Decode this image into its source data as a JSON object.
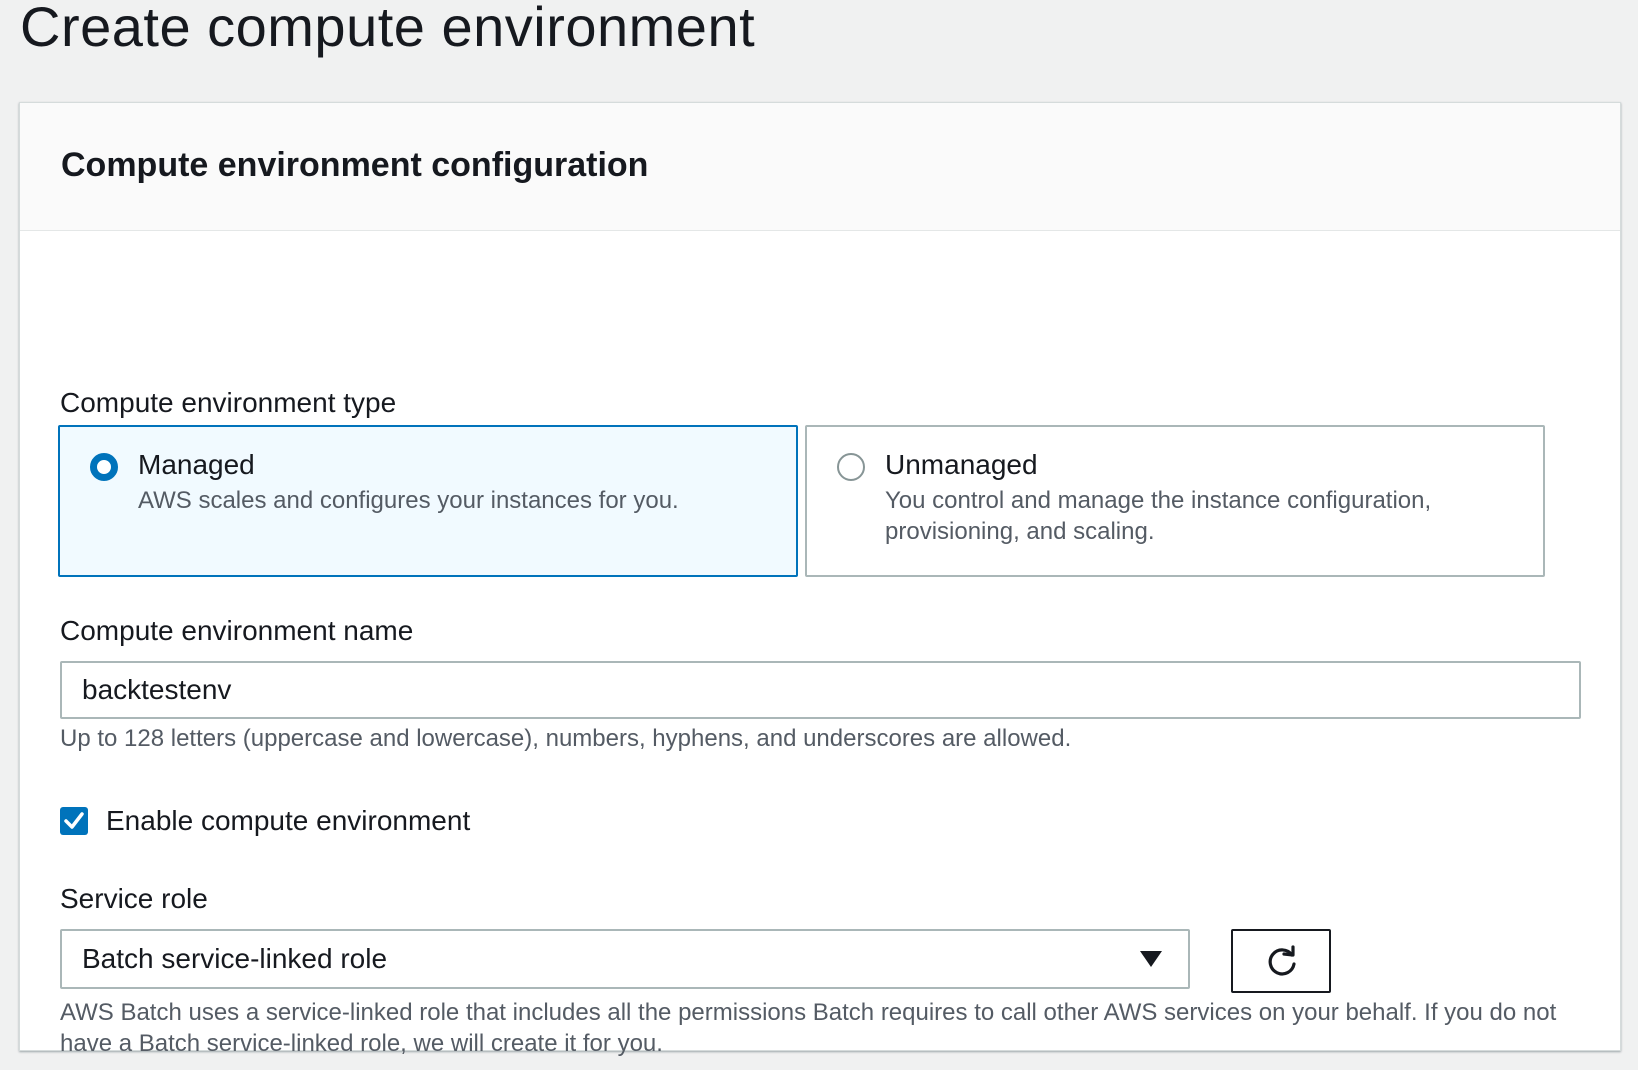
{
  "page": {
    "title": "Create compute environment"
  },
  "panel": {
    "heading": "Compute environment configuration"
  },
  "env_type": {
    "label": "Compute environment type",
    "options": [
      {
        "title": "Managed",
        "description": "AWS scales and configures your instances for you.",
        "selected": true
      },
      {
        "title": "Unmanaged",
        "description": "You control and manage the instance configuration, provisioning, and scaling.",
        "selected": false
      }
    ]
  },
  "env_name": {
    "label": "Compute environment name",
    "value": "backtestenv",
    "hint": "Up to 128 letters (uppercase and lowercase), numbers, hyphens, and underscores are allowed."
  },
  "enable": {
    "label": "Enable compute environment",
    "checked": true
  },
  "service_role": {
    "label": "Service role",
    "selected": "Batch service-linked role",
    "hint": "AWS Batch uses a service-linked role that includes all the permissions Batch requires to call other AWS services on your behalf. If you do not have a Batch service-linked role, we will create it for you."
  },
  "icons": {
    "radio_selected": "radio-selected-icon",
    "radio_unselected": "radio-unselected-icon",
    "checkbox_checked": "check-icon",
    "dropdown": "caret-down-icon",
    "refresh": "refresh-icon"
  },
  "colors": {
    "accent": "#0073bb",
    "selected_tile_bg": "#f1faff",
    "text": "#16191f",
    "secondary_text": "#545b64",
    "border": "#aab7b8"
  }
}
